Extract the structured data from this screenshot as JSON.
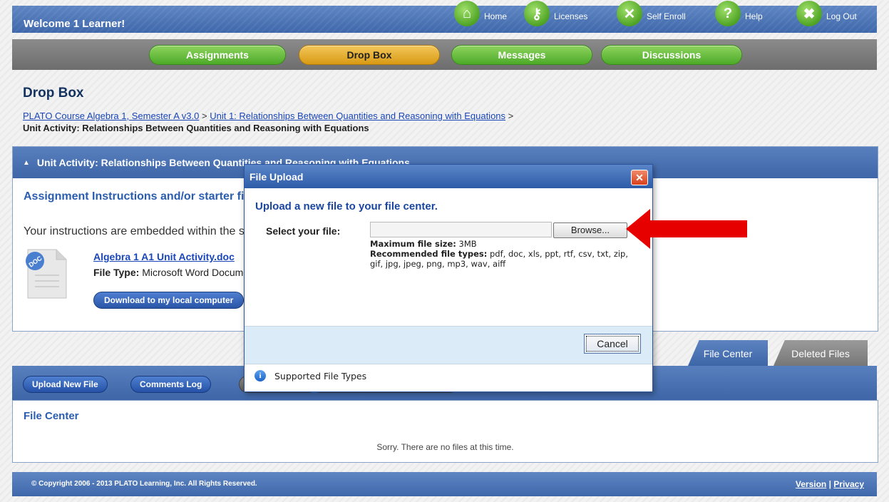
{
  "topbar": {
    "welcome": "Welcome 1 Learner!",
    "links": [
      {
        "label": "Home",
        "icon": "home-icon"
      },
      {
        "label": "Licenses",
        "icon": "key-icon"
      },
      {
        "label": "Self Enroll",
        "icon": "tools-icon"
      },
      {
        "label": "Help",
        "icon": "help-icon"
      },
      {
        "label": "Log Out",
        "icon": "close-icon"
      }
    ]
  },
  "nav": {
    "tabs": [
      "Assignments",
      "Drop Box",
      "Messages",
      "Discussions"
    ],
    "active": "Drop Box"
  },
  "page": {
    "title": "Drop Box",
    "breadcrumb": {
      "course": "PLATO Course Algebra 1, Semester A v3.0",
      "unit": "Unit 1: Relationships Between Quantities and Reasoning with Equations",
      "sep": ">",
      "current": "Unit Activity: Relationships Between Quantities and Reasoning with Equations"
    }
  },
  "unit_panel": {
    "header": "Unit Activity: Relationships Between Quantities and Reasoning with Equations",
    "instructions_heading": "Assignment Instructions and/or starter file",
    "instructions_text": "Your instructions are embedded within the starter file below.",
    "doc_icon_label": "DOC",
    "doc_link": "Algebra 1 A1 Unit Activity.doc",
    "file_type_label": "File Type:",
    "file_type_value": "Microsoft Word Document",
    "download_button": "Download to my local computer"
  },
  "file_tabs": [
    "File Center",
    "Deleted Files"
  ],
  "file_center": {
    "buttons": [
      "Upload New File",
      "Comments Log",
      "",
      ""
    ],
    "title": "File Center",
    "empty_message": "Sorry. There are no files at this time."
  },
  "footer": {
    "copyright": "© Copyright 2006 - 2013 PLATO Learning, Inc. All Rights Reserved.",
    "version": "Version",
    "sep": "|",
    "privacy": "Privacy"
  },
  "modal": {
    "title": "File Upload",
    "heading": "Upload a new file to your file center.",
    "select_label": "Select your file:",
    "file_value": "",
    "browse_button": "Browse...",
    "max_size_label": "Maximum file size:",
    "max_size_value": "3MB",
    "recommended_label": "Recommended file types:",
    "recommended_value": "pdf, doc, xls, ppt, rtf, csv, txt, zip, gif, jpg, jpeg, png, mp3, wav, aiff",
    "cancel_button": "Cancel",
    "supported_link": "Supported File Types"
  },
  "colors": {
    "header_blue": "#3f68ab",
    "nav_green": "#4caa28",
    "nav_active": "#d99a14",
    "arrow_red": "#e60000"
  }
}
